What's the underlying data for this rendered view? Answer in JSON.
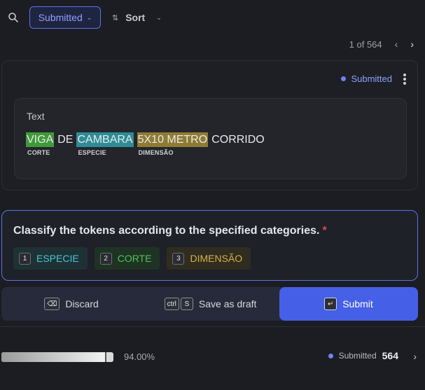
{
  "filter": {
    "label": "Submitted",
    "icon": "chevron-down-icon"
  },
  "sort": {
    "label": "Sort",
    "icon": "sort-icon"
  },
  "pager": {
    "text": "1 of 564"
  },
  "record": {
    "status": "Submitted",
    "text_label": "Text",
    "tokens": [
      {
        "word": "VIGA",
        "entity": "CORTE"
      },
      {
        "word": "DE",
        "entity": ""
      },
      {
        "word": "CAMBARA",
        "entity": "ESPECIE"
      },
      {
        "word": "5X10 METRO",
        "entity": "DIMENSÃO"
      },
      {
        "word": "CORRIDO",
        "entity": ""
      }
    ]
  },
  "task": {
    "title": "Classify the tokens according to the specified categories.",
    "required_mark": "*",
    "labels": [
      {
        "key": "1",
        "name": "ESPECIE",
        "color": "#47c7d2"
      },
      {
        "key": "2",
        "name": "CORTE",
        "color": "#4cc456"
      },
      {
        "key": "3",
        "name": "DIMENSÃO",
        "color": "#d5b24a"
      }
    ]
  },
  "actions": {
    "discard": {
      "label": "Discard",
      "key": "⌫"
    },
    "draft": {
      "label": "Save as draft",
      "key1": "ctrl",
      "key2": "S"
    },
    "submit": {
      "label": "Submit",
      "key": "↵"
    }
  },
  "footer": {
    "progress": 0.94,
    "progress_text": "94.00%",
    "status_label": "Submitted",
    "status_count": "564"
  },
  "colors": {
    "accent": "#4560e6",
    "background": "#1b1d22"
  }
}
